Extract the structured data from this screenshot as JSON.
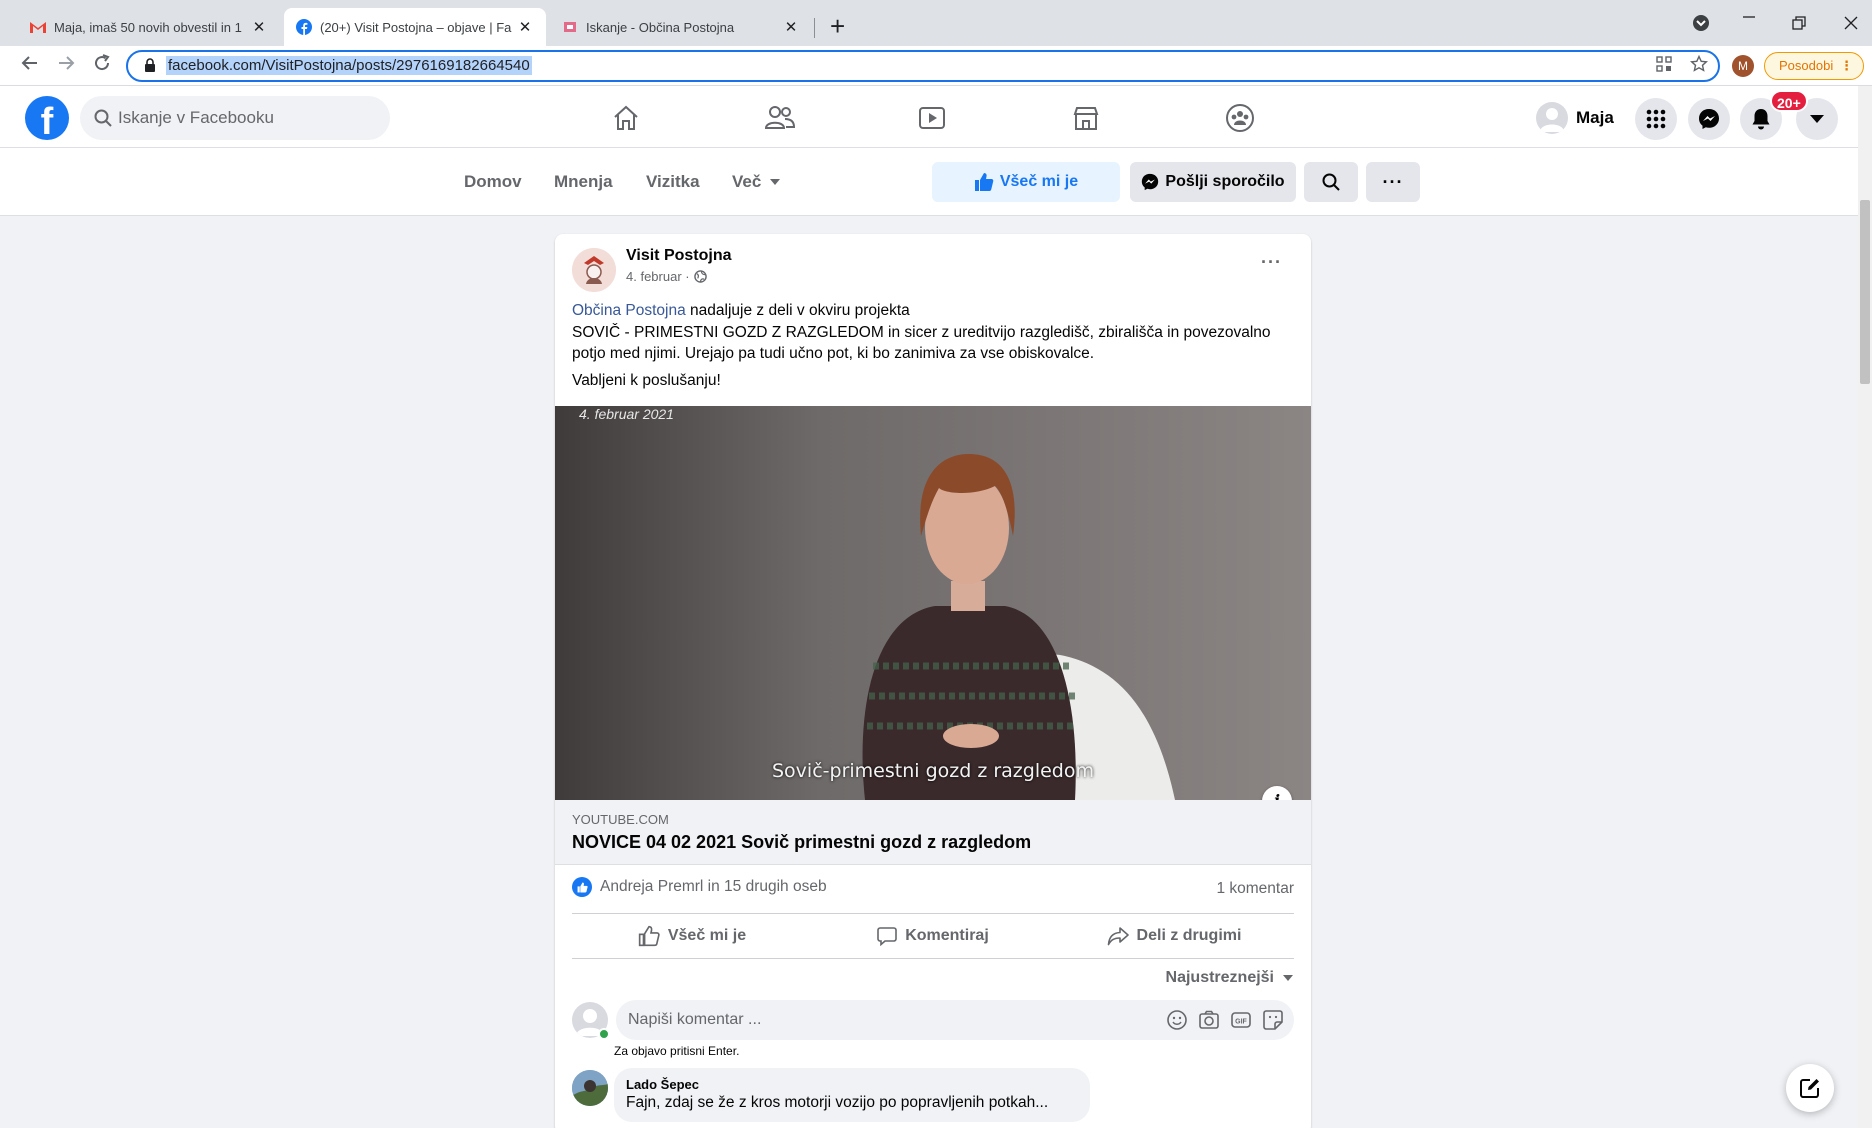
{
  "browser": {
    "tabs": [
      {
        "title": "Maja, imaš 50 novih obvestil in 1",
        "close": "✕"
      },
      {
        "title": "(20+) Visit Postojna – objave | Fa",
        "close": "✕"
      },
      {
        "title": "Iskanje - Občina Postojna",
        "close": "✕"
      }
    ],
    "new_tab": "+",
    "url": "facebook.com/VisitPostojna/posts/2976169182664540",
    "profile_initial": "M",
    "update_label": "Posodobi",
    "update_menu": "⋮"
  },
  "facebook": {
    "logo": "f",
    "search_placeholder": "Iskanje v Facebooku",
    "user_name": "Maja",
    "notification_badge": "20+",
    "icons": [
      "home-icon",
      "friends-icon",
      "watch-icon",
      "marketplace-icon",
      "groups-icon",
      "menu-grid-icon",
      "messenger-icon",
      "bell-icon",
      "account-caret-icon"
    ]
  },
  "page_nav": {
    "links": [
      "Domov",
      "Mnenja",
      "Vizitka",
      "Več"
    ],
    "like_label": "Všeč mi je",
    "message_label": "Pošlji sporočilo",
    "more_label": "···"
  },
  "post": {
    "author": "Visit Postojna",
    "date": "4. februar ·",
    "menu": "···",
    "mention": "Občina Postojna",
    "text_after_mention": " nadaljuje z deli v okviru projekta",
    "text_body": "SOVIČ - PRIMESTNI GOZD Z RAZGLEDOM in sicer z ureditvijo razgledišč, zbirališča in povezovalno potjo med njimi. Urejajo pa tudi učno pot, ki bo zanimiva za vse obiskovalce.",
    "text_tail": "Vabljeni k poslušanju!",
    "media": {
      "date_overlay": "4. februar 2021",
      "subtitle": "Sovič-primestni gozd z razgledom",
      "info": "i"
    },
    "link": {
      "domain": "YOUTUBE.COM",
      "title": "NOVICE 04 02 2021 Sovič primestni gozd z razgledom"
    },
    "reactions_text": "Andreja Premrl in 15 drugih oseb",
    "comments_count": "1 komentar",
    "actions": {
      "like": "Všeč mi je",
      "comment": "Komentiraj",
      "share": "Deli z drugimi"
    },
    "sort_label": "Najustreznejši",
    "comment_input": {
      "placeholder": "Napiši komentar ...",
      "hint": "Za objavo pritisni Enter."
    },
    "comments": [
      {
        "author": "Lado Šepec",
        "text": "Fajn, zdaj se že z kros motorji vozijo po popravljenih potkah..."
      }
    ]
  },
  "colors": {
    "facebook_blue": "#1877f2",
    "background": "#f0f2f5",
    "secondary_text": "#65676b",
    "notification_red": "#e41e3f"
  }
}
